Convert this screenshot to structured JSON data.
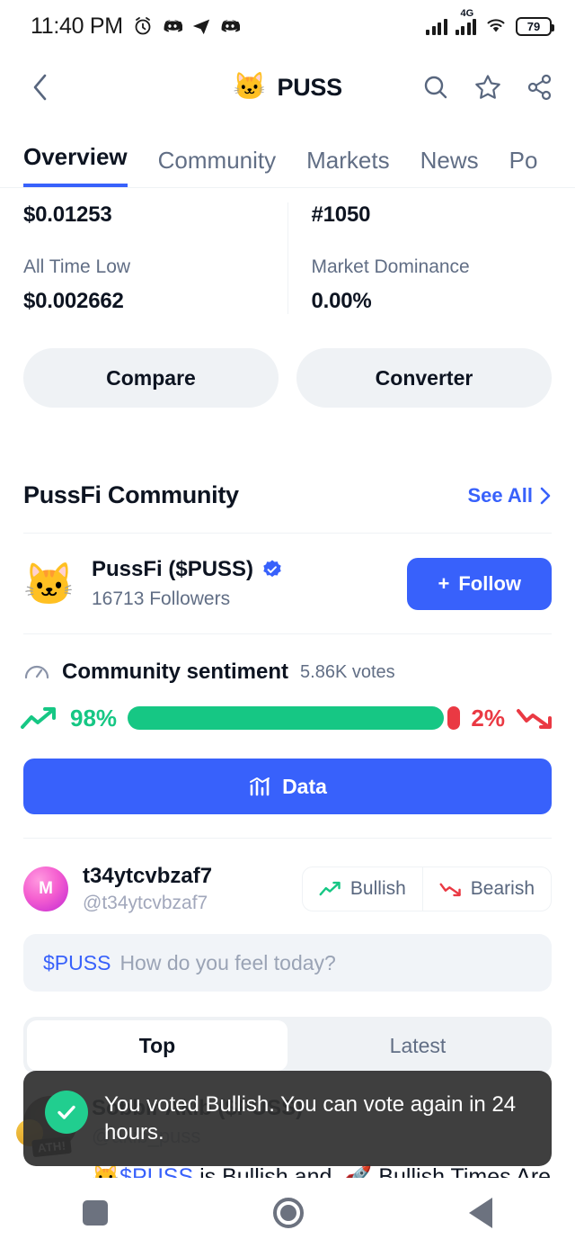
{
  "status_bar": {
    "time": "11:40 PM",
    "network_label": "4G",
    "battery": "79",
    "icons": [
      "alarm-icon",
      "discord-icon",
      "telegram-icon",
      "discord-icon",
      "signal-icon",
      "network-4g-icon",
      "wifi-icon",
      "battery-icon"
    ]
  },
  "header": {
    "back_icon": "chevron-left-icon",
    "coin_emoji": "🐱",
    "title": "PUSS",
    "actions": [
      {
        "name": "search-icon"
      },
      {
        "name": "star-icon"
      },
      {
        "name": "share-icon"
      }
    ]
  },
  "tabs": [
    {
      "label": "Overview",
      "active": true
    },
    {
      "label": "Community",
      "active": false
    },
    {
      "label": "Markets",
      "active": false
    },
    {
      "label": "News",
      "active": false
    },
    {
      "label": "Po",
      "active": false
    }
  ],
  "stats": {
    "left_value": "$0.01253",
    "right_value": "#1050",
    "left_label": "All Time Low",
    "left_label_value": "$0.002662",
    "right_label": "Market Dominance",
    "right_label_value": "0.00%"
  },
  "action_pills": [
    {
      "label": "Compare"
    },
    {
      "label": "Converter"
    }
  ],
  "community": {
    "section_title": "PussFi Community",
    "see_all": "See All",
    "see_all_icon": "chevron-right-icon",
    "profile": {
      "avatar_emoji": "🐱",
      "name": "PussFi ($PUSS)",
      "verified": true,
      "followers": "16713 Followers",
      "follow_label": "Follow",
      "follow_plus": "+"
    }
  },
  "sentiment": {
    "gauge_icon": "gauge-icon",
    "title": "Community sentiment",
    "votes": "5.86K votes",
    "bullish_pct": "98%",
    "bearish_pct": "2%",
    "bullish_value": 98,
    "bearish_value": 2,
    "bullish_color": "#16c784",
    "bearish_color": "#ea3943",
    "data_button": "Data",
    "data_icon": "chart-icon"
  },
  "composer_user": {
    "avatar_glyph": "M",
    "name": "t34ytcvbzaf7",
    "handle": "@t34ytcvbzaf7",
    "bullish_label": "Bullish",
    "bearish_label": "Bearish"
  },
  "composer": {
    "ticker": "$PUSS",
    "placeholder": "How do you feel today?"
  },
  "feed_filter": [
    {
      "label": "Top",
      "active": true
    },
    {
      "label": "Latest",
      "active": false
    }
  ],
  "post": {
    "author": "Sobbir Akib ($PUSS)",
    "handle": "@akib_puss",
    "badge": "ATH!",
    "text_emoji": "🐱",
    "text_ticker": "$PUSS",
    "text_rest": " is Bullish and, 🚀 Bullish Times Are"
  },
  "toast": {
    "icon": "check-circle-icon",
    "message": "You voted Bullish. You can vote again in 24 hours."
  },
  "nav_bar": {
    "recent": "square-icon",
    "home": "circle-icon",
    "back": "triangle-back-icon"
  }
}
